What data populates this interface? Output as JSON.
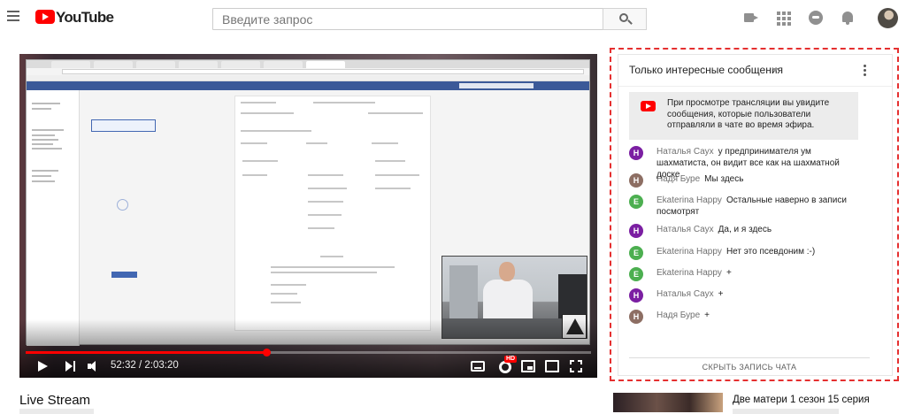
{
  "app": {
    "name": "YouTube",
    "logo_text": "YouTube"
  },
  "search": {
    "placeholder": "Введите запрос"
  },
  "header_icons": [
    "menu-icon",
    "create-video-icon",
    "apps-icon",
    "messages-icon",
    "notifications-bell-icon",
    "avatar"
  ],
  "player": {
    "time_current": "52:32",
    "time_total": "2:03:20",
    "time_display": "52:32 / 2:03:20",
    "progress": 0.425,
    "hd_label": "HD"
  },
  "video": {
    "title": "Live Stream"
  },
  "chat": {
    "mode_label": "Только интересные сообщения",
    "banner_text": "При просмотре трансляции вы увидите сообщения, которые пользователи отправляли в чате во время эфира.",
    "messages": [
      {
        "author": "Наталья Саух",
        "text": "у предпринимателя ум шахматиста, он видит все как на шахматной доске",
        "initial": "Н",
        "color": "#7b1fa2"
      },
      {
        "author": "Надя Буре",
        "text": "Мы здесь",
        "initial": "Н",
        "color": "#8d6e63"
      },
      {
        "author": "Ekaterina Happy",
        "text": "Остальные наверно в записи посмотрят",
        "initial": "E",
        "color": "#4caf50"
      },
      {
        "author": "Наталья Саух",
        "text": "Да, и я здесь",
        "initial": "Н",
        "color": "#7b1fa2"
      },
      {
        "author": "Ekaterina Happy",
        "text": "Нет это псевдоним :-)",
        "initial": "E",
        "color": "#4caf50"
      },
      {
        "author": "Ekaterina Happy",
        "text": "+",
        "initial": "E",
        "color": "#4caf50"
      },
      {
        "author": "Наталья Саух",
        "text": "+",
        "initial": "Н",
        "color": "#7b1fa2"
      },
      {
        "author": "Надя Буре",
        "text": "+",
        "initial": "Н",
        "color": "#8d6e63"
      }
    ],
    "hide_button": "СКРЫТЬ ЗАПИСЬ ЧАТА"
  },
  "recommendation": {
    "title": "Две матери 1 сезон 15 серия"
  },
  "colors": {
    "brand": "#ff0000",
    "highlight": "#e53030"
  }
}
